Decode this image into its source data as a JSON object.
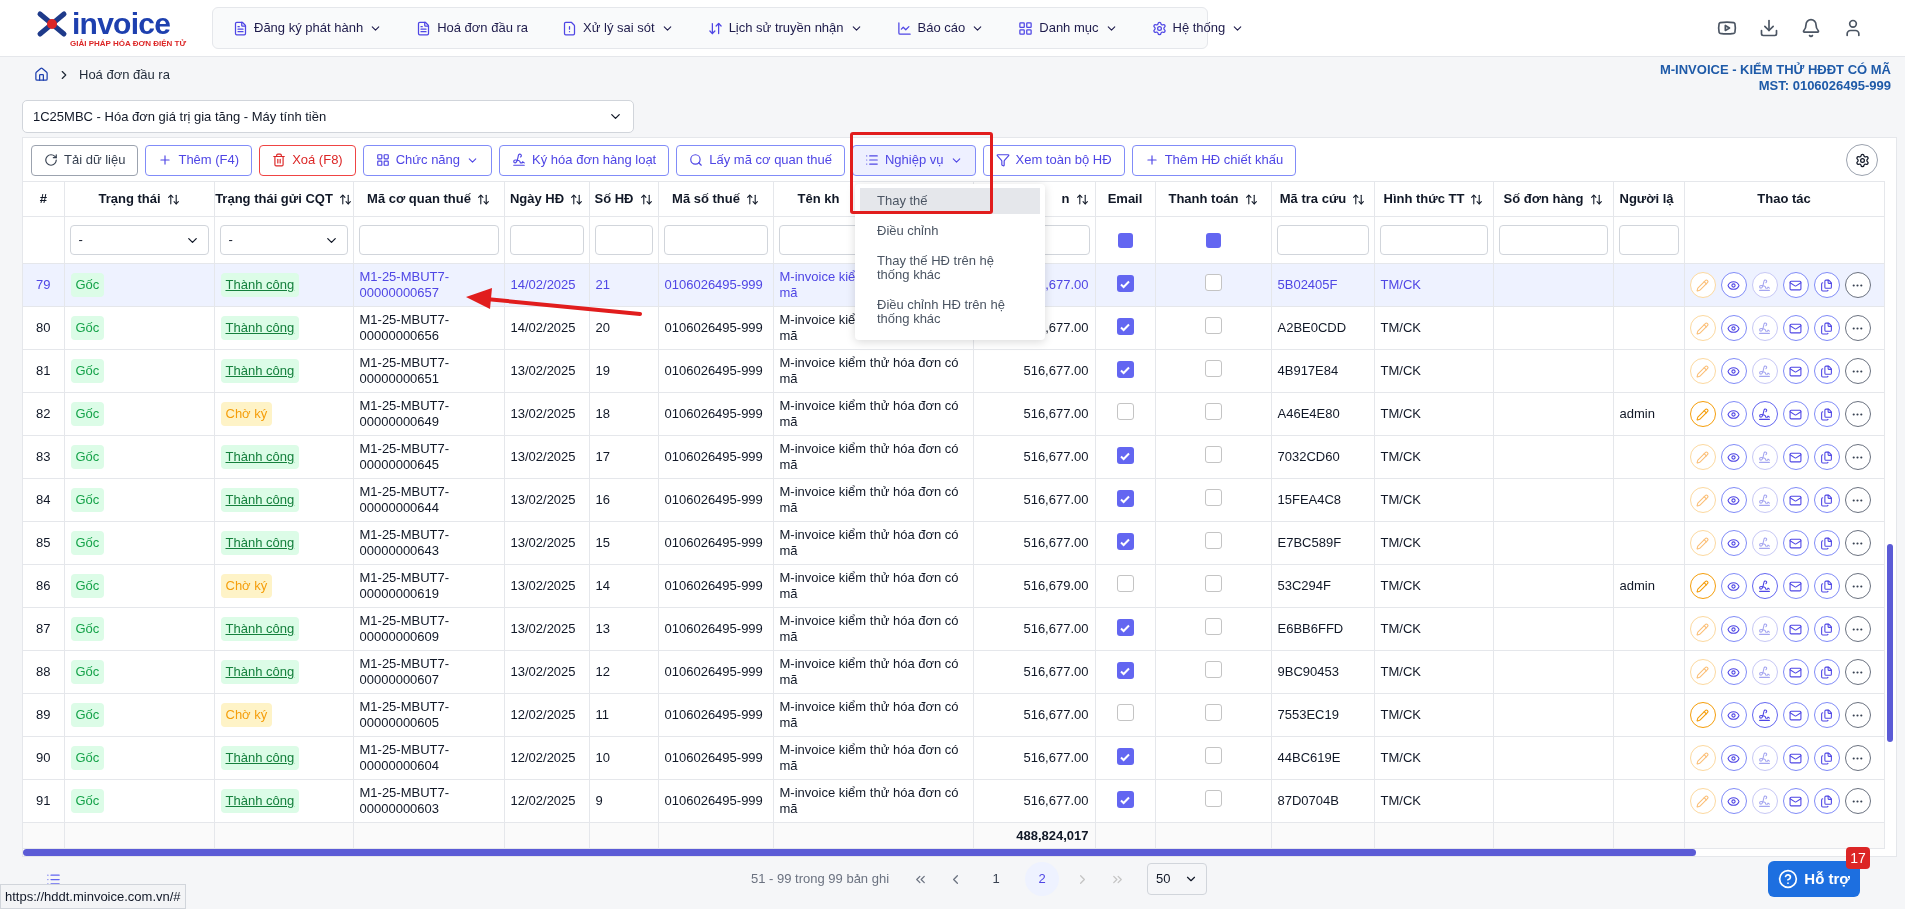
{
  "logo": {
    "name": "invoice",
    "tagline": "GIẢI PHÁP HÓA ĐƠN ĐIỆN TỬ"
  },
  "nav": [
    {
      "label": "Đăng ký phát hành",
      "caret": true
    },
    {
      "label": "Hoá đơn đầu ra",
      "caret": false
    },
    {
      "label": "Xử lý sai sót",
      "caret": true
    },
    {
      "label": "Lịch sử truyền nhận",
      "caret": true
    },
    {
      "label": "Báo cáo",
      "caret": true
    },
    {
      "label": "Danh mục",
      "caret": true
    },
    {
      "label": "Hệ thống",
      "caret": true
    }
  ],
  "breadcrumb": [
    "Hoá đơn đầu ra"
  ],
  "company": {
    "name": "M-INVOICE - KIỂM THỬ HĐĐT CÓ MÃ",
    "mst": "MST: 0106026495-999"
  },
  "series_select": {
    "value": "1C25MBC - Hóa đơn giá trị gia tăng - Máy tính tiền"
  },
  "toolbar": [
    {
      "label": "Tải dữ liệu",
      "caret": false,
      "selected": false
    },
    {
      "label": "Thêm (F4)",
      "caret": false,
      "selected": false
    },
    {
      "label": "Xoá (F8)",
      "caret": false,
      "selected": false
    },
    {
      "label": "Chức năng",
      "caret": true,
      "selected": false
    },
    {
      "label": "Ký hóa đơn hàng loạt",
      "caret": false,
      "selected": false
    },
    {
      "label": "Lấy mã cơ quan thuế",
      "caret": false,
      "selected": false
    },
    {
      "label": "Nghiệp vụ",
      "caret": true,
      "selected": true
    },
    {
      "label": "Xem toàn bộ HĐ",
      "caret": false,
      "selected": false
    },
    {
      "label": "Thêm HĐ chiết khấu",
      "caret": false,
      "selected": false
    }
  ],
  "menu": {
    "items": [
      {
        "label": "Thay thế",
        "selected": true
      },
      {
        "label": "Điều chỉnh",
        "selected": false
      },
      {
        "label": "Thay thế HĐ trên hệ thống khác",
        "selected": false
      },
      {
        "label": "Điều chỉnh HĐ trên hệ thống khác",
        "selected": false
      }
    ]
  },
  "table": {
    "columns": [
      {
        "label": "#",
        "sortable": false
      },
      {
        "label": "Trạng thái",
        "sortable": true
      },
      {
        "label": "Trạng thái gửi CQT",
        "sortable": true
      },
      {
        "label": "Mã cơ quan thuế",
        "sortable": true
      },
      {
        "label": "Ngày HĐ",
        "sortable": true
      },
      {
        "label": "Số HĐ",
        "sortable": true
      },
      {
        "label": "Mã số thuế",
        "sortable": true
      },
      {
        "label": "Tên kh",
        "sortable": false
      },
      {
        "label": "n",
        "sortable": true
      },
      {
        "label": "Email",
        "sortable": false
      },
      {
        "label": "Thanh toán",
        "sortable": true
      },
      {
        "label": "Mã tra cứu",
        "sortable": true
      },
      {
        "label": "Hình thức TT",
        "sortable": true
      },
      {
        "label": "Số đơn hàng",
        "sortable": true
      },
      {
        "label": "Người lậ"
      },
      {
        "label": "Thao tác",
        "sortable": false
      }
    ],
    "filters": [
      {
        "kind": "none"
      },
      {
        "kind": "select",
        "value": "-"
      },
      {
        "kind": "select",
        "value": "-"
      },
      {
        "kind": "input"
      },
      {
        "kind": "input"
      },
      {
        "kind": "input"
      },
      {
        "kind": "input"
      },
      {
        "kind": "input"
      },
      {
        "kind": "input"
      },
      {
        "kind": "check",
        "checked": true
      },
      {
        "kind": "check",
        "checked": true
      },
      {
        "kind": "input"
      },
      {
        "kind": "input"
      },
      {
        "kind": "input"
      },
      {
        "kind": "input"
      },
      {
        "kind": "none"
      }
    ],
    "rows": [
      {
        "no": "79",
        "type": "Gốc",
        "status": {
          "label": "Thành công",
          "kind": "success"
        },
        "code": "M1-25-MBUT7-00000000657",
        "date": "14/02/2025",
        "number": "21",
        "tax_id": "0106026495-999",
        "customer": "M-invoice kiể\nmã",
        "amount": ",677.00",
        "email": true,
        "paid": false,
        "lookup": "5B02405F",
        "payment": "TM/CK",
        "editable": false,
        "selected": true
      },
      {
        "no": "80",
        "type": "Gốc",
        "status": {
          "label": "Thành công",
          "kind": "success"
        },
        "code": "M1-25-MBUT7-00000000656",
        "date": "14/02/2025",
        "number": "20",
        "tax_id": "0106026495-999",
        "customer": "M-invoice kiể\nmã",
        "amount": ",677.00",
        "email": true,
        "paid": false,
        "lookup": "A2BE0CDD",
        "payment": "TM/CK",
        "editable": false,
        "selected": false
      },
      {
        "no": "81",
        "type": "Gốc",
        "status": {
          "label": "Thành công",
          "kind": "success"
        },
        "code": "M1-25-MBUT7-00000000651",
        "date": "13/02/2025",
        "number": "19",
        "tax_id": "0106026495-999",
        "customer": "M-invoice kiểm thử hóa đơn có mã",
        "amount": "516,677.00",
        "email": true,
        "paid": false,
        "lookup": "4B917E84",
        "payment": "TM/CK",
        "editable": false,
        "selected": false
      },
      {
        "no": "82",
        "type": "Gốc",
        "status": {
          "label": "Chờ ký",
          "kind": "pending"
        },
        "code": "M1-25-MBUT7-00000000649",
        "date": "13/02/2025",
        "number": "18",
        "tax_id": "0106026495-999",
        "customer": "M-invoice kiểm thử hóa đơn có mã",
        "amount": "516,677.00",
        "email": false,
        "paid": false,
        "lookup": "A46E4E80",
        "payment": "TM/CK",
        "creator": "admin",
        "editable": true,
        "selected": false
      },
      {
        "no": "83",
        "type": "Gốc",
        "status": {
          "label": "Thành công",
          "kind": "success"
        },
        "code": "M1-25-MBUT7-00000000645",
        "date": "13/02/2025",
        "number": "17",
        "tax_id": "0106026495-999",
        "customer": "M-invoice kiểm thử hóa đơn có mã",
        "amount": "516,677.00",
        "email": true,
        "paid": false,
        "lookup": "7032CD60",
        "payment": "TM/CK",
        "editable": false,
        "selected": false
      },
      {
        "no": "84",
        "type": "Gốc",
        "status": {
          "label": "Thành công",
          "kind": "success"
        },
        "code": "M1-25-MBUT7-00000000644",
        "date": "13/02/2025",
        "number": "16",
        "tax_id": "0106026495-999",
        "customer": "M-invoice kiểm thử hóa đơn có mã",
        "amount": "516,677.00",
        "email": true,
        "paid": false,
        "lookup": "15FEA4C8",
        "payment": "TM/CK",
        "editable": false,
        "selected": false
      },
      {
        "no": "85",
        "type": "Gốc",
        "status": {
          "label": "Thành công",
          "kind": "success"
        },
        "code": "M1-25-MBUT7-00000000643",
        "date": "13/02/2025",
        "number": "15",
        "tax_id": "0106026495-999",
        "customer": "M-invoice kiểm thử hóa đơn có mã",
        "amount": "516,677.00",
        "email": true,
        "paid": false,
        "lookup": "E7BC589F",
        "payment": "TM/CK",
        "editable": false,
        "selected": false
      },
      {
        "no": "86",
        "type": "Gốc",
        "status": {
          "label": "Chờ ký",
          "kind": "pending"
        },
        "code": "M1-25-MBUT7-00000000619",
        "date": "13/02/2025",
        "number": "14",
        "tax_id": "0106026495-999",
        "customer": "M-invoice kiểm thử hóa đơn có mã",
        "amount": "516,679.00",
        "email": false,
        "paid": false,
        "lookup": "53C294F",
        "payment": "TM/CK",
        "creator": "admin",
        "editable": true,
        "selected": false
      },
      {
        "no": "87",
        "type": "Gốc",
        "status": {
          "label": "Thành công",
          "kind": "success"
        },
        "code": "M1-25-MBUT7-00000000609",
        "date": "13/02/2025",
        "number": "13",
        "tax_id": "0106026495-999",
        "customer": "M-invoice kiểm thử hóa đơn có mã",
        "amount": "516,677.00",
        "email": true,
        "paid": false,
        "lookup": "E6BB6FFD",
        "payment": "TM/CK",
        "editable": false,
        "selected": false
      },
      {
        "no": "88",
        "type": "Gốc",
        "status": {
          "label": "Thành công",
          "kind": "success"
        },
        "code": "M1-25-MBUT7-00000000607",
        "date": "13/02/2025",
        "number": "12",
        "tax_id": "0106026495-999",
        "customer": "M-invoice kiểm thử hóa đơn có mã",
        "amount": "516,677.00",
        "email": true,
        "paid": false,
        "lookup": "9BC90453",
        "payment": "TM/CK",
        "editable": false,
        "selected": false
      },
      {
        "no": "89",
        "type": "Gốc",
        "status": {
          "label": "Chờ ký",
          "kind": "pending"
        },
        "code": "M1-25-MBUT7-00000000605",
        "date": "12/02/2025",
        "number": "11",
        "tax_id": "0106026495-999",
        "customer": "M-invoice kiểm thử hóa đơn có mã",
        "amount": "516,677.00",
        "email": false,
        "paid": false,
        "lookup": "7553EC19",
        "payment": "TM/CK",
        "editable": true,
        "selected": false
      },
      {
        "no": "90",
        "type": "Gốc",
        "status": {
          "label": "Thành công",
          "kind": "success"
        },
        "code": "M1-25-MBUT7-00000000604",
        "date": "12/02/2025",
        "number": "10",
        "tax_id": "0106026495-999",
        "customer": "M-invoice kiểm thử hóa đơn có mã",
        "amount": "516,677.00",
        "email": true,
        "paid": false,
        "lookup": "44BC619E",
        "payment": "TM/CK",
        "editable": false,
        "selected": false
      },
      {
        "no": "91",
        "type": "Gốc",
        "status": {
          "label": "Thành công",
          "kind": "success"
        },
        "code": "M1-25-MBUT7-00000000603",
        "date": "12/02/2025",
        "number": "9",
        "tax_id": "0106026495-999",
        "customer": "M-invoice kiểm thử hóa đơn có mã",
        "amount": "516,677.00",
        "email": true,
        "paid": false,
        "lookup": "87D0704B",
        "payment": "TM/CK",
        "editable": false,
        "selected": false
      }
    ],
    "total": "488,824,017"
  },
  "pagination": {
    "summary": "51 - 99 trong 99 bản ghi",
    "pages": [
      {
        "label": "1",
        "selected": false
      },
      {
        "label": "2",
        "selected": true
      }
    ],
    "page_size": "50"
  },
  "status_url": "https://hddt.minvoice.com.vn/#",
  "help": {
    "label": "Hỗ trợ",
    "badge": "17"
  }
}
